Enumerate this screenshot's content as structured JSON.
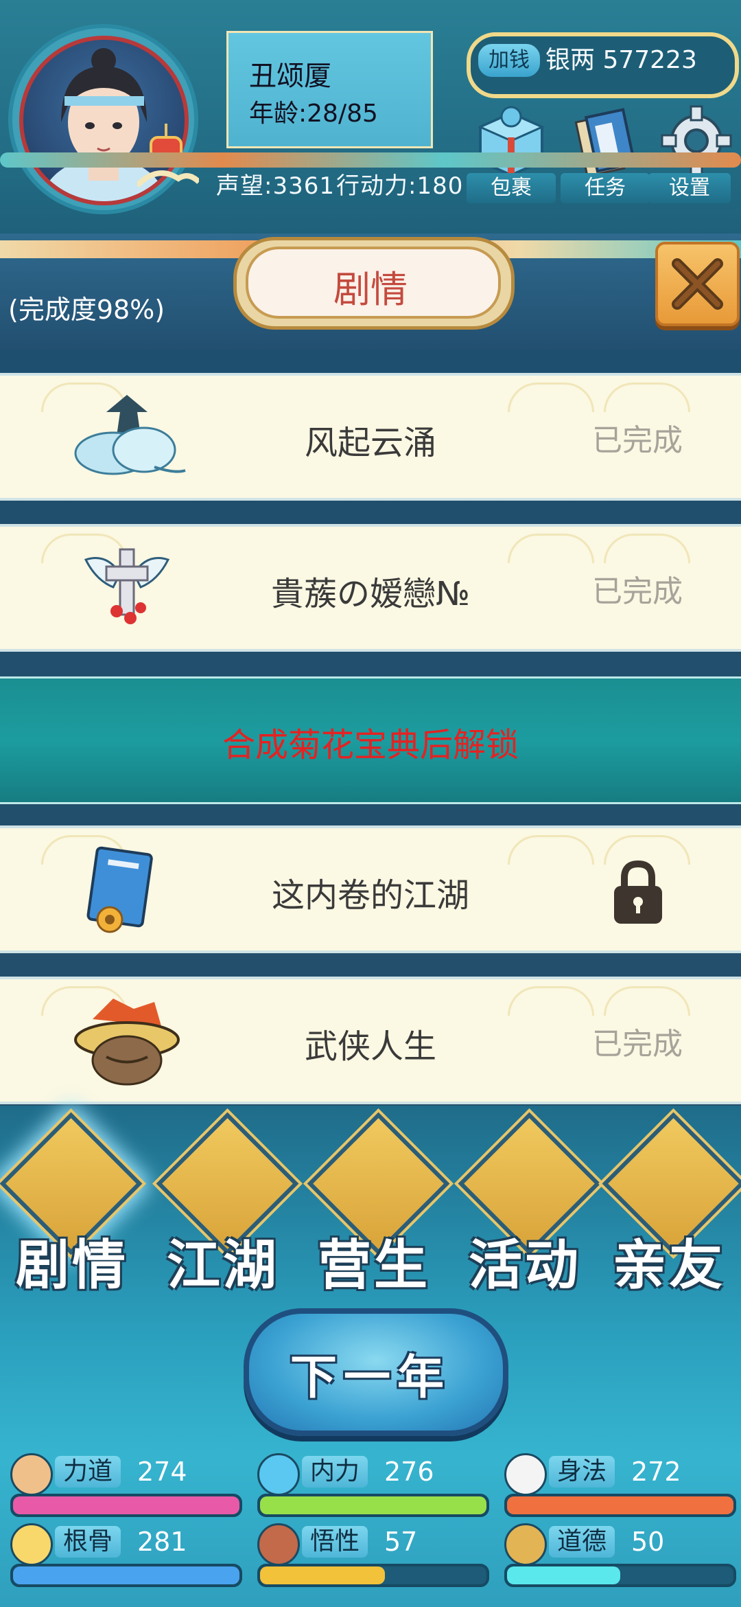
{
  "player": {
    "name": "丑颂厦",
    "age": "年龄:28/85",
    "reputation": "声望:3361",
    "action_points": "行动力:180"
  },
  "currency": {
    "add_button": "加钱",
    "silver": "银两 577223"
  },
  "top_menu": [
    {
      "label": "包裹",
      "icon": "gift-box-icon"
    },
    {
      "label": "任务",
      "icon": "books-icon"
    },
    {
      "label": "设置",
      "icon": "gear-icon"
    }
  ],
  "page": {
    "title": "剧情",
    "completion": "(完成度98%)"
  },
  "stories": [
    {
      "title": "风起云涌",
      "status": "已完成",
      "icon": "cloud-icon"
    },
    {
      "title": "貴蔟の嫒戀№",
      "status": "已完成",
      "icon": "winged-cross-icon"
    },
    {
      "title": "这内卷的江湖",
      "status": "",
      "icon": "book-icon",
      "locked": true
    },
    {
      "title": "武侠人生",
      "status": "已完成",
      "icon": "straw-hat-hero-icon"
    }
  ],
  "locked_banner": "合成菊花宝典后解锁",
  "nav": [
    {
      "label": "剧情"
    },
    {
      "label": "江湖"
    },
    {
      "label": "营生"
    },
    {
      "label": "活动"
    },
    {
      "label": "亲友"
    }
  ],
  "next_year": "下一年",
  "attributes": [
    {
      "label": "力道",
      "value": "274",
      "color": "#e85aa8",
      "fill": 1.0
    },
    {
      "label": "内力",
      "value": "276",
      "color": "#98e04a",
      "fill": 1.0
    },
    {
      "label": "身法",
      "value": "272",
      "color": "#f07040",
      "fill": 1.0
    },
    {
      "label": "根骨",
      "value": "281",
      "color": "#4aa3ee",
      "fill": 1.0
    },
    {
      "label": "悟性",
      "value": "57",
      "color": "#f2c23a",
      "fill": 0.55
    },
    {
      "label": "道德",
      "value": "50",
      "color": "#5ae8ec",
      "fill": 0.5
    }
  ]
}
